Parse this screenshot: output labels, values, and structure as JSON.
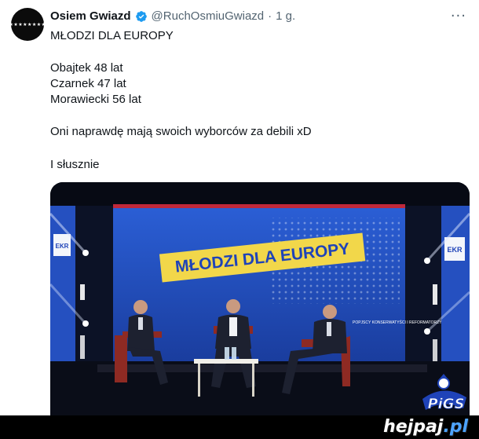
{
  "tweet": {
    "author_name": "Osiem Gwiazd",
    "handle": "@RuchOsmiuGwiazd",
    "separator": "·",
    "time": "1 g.",
    "more": "···",
    "lines": [
      "MŁODZI DLA EUROPY",
      "Obajtek 48 lat",
      "Czarnek 47 lat",
      "Morawiecki 56 lat",
      "Oni naprawdę mają swoich wyborców za debili xD",
      "I słusznie"
    ]
  },
  "media": {
    "banner_text": "MŁODZI DLA EUROPY",
    "ekr_left": "EKR",
    "ekr_right": "EKR",
    "panel_text": "POPJSCY KONSERWATYŚCI I REFORMATORZY"
  },
  "watermark": {
    "brand_letters": "hejpaj",
    "domain": ".pl",
    "mascot_text": "PiGS"
  },
  "colors": {
    "verified": "#1d9bf0",
    "banner_yellow": "#f2d74a",
    "banner_blue": "#1f43b8",
    "stage_blue": "#1e4fc4"
  }
}
